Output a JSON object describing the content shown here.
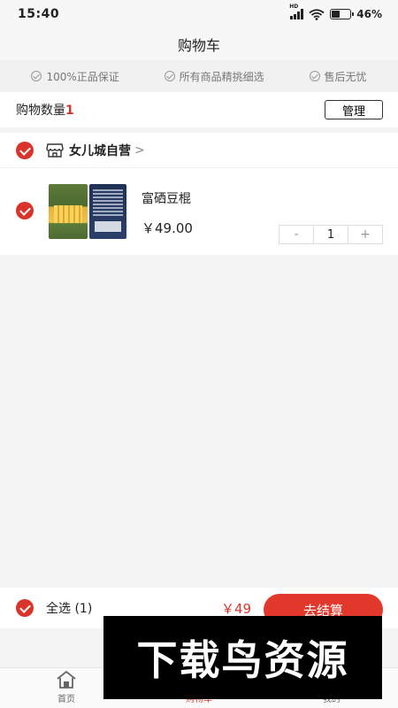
{
  "status": {
    "time": "15:40",
    "battery": "46%",
    "battery_level": 0.46,
    "network": "HD"
  },
  "header": {
    "title": "购物车"
  },
  "guarantees": [
    {
      "label": "100%正品保证"
    },
    {
      "label": "所有商品精挑细选"
    },
    {
      "label": "售后无忧"
    }
  ],
  "cart": {
    "count_label": "购物数量",
    "count": "1",
    "manage_label": "管理"
  },
  "store": {
    "name": "女儿城自营",
    "chevron": ">"
  },
  "item": {
    "name": "富硒豆棍",
    "price": "￥49.00",
    "quantity": "1",
    "minus": "-",
    "plus": "+"
  },
  "checkout": {
    "select_all": "全选 (1)",
    "total": "￥49",
    "button": "去结算"
  },
  "tabs": [
    {
      "label": "首页"
    },
    {
      "label": "购物车"
    },
    {
      "label": "我的"
    }
  ],
  "watermark": {
    "text": "下载鸟资源"
  },
  "colors": {
    "accent": "#d9342b",
    "button": "#e2382c"
  }
}
